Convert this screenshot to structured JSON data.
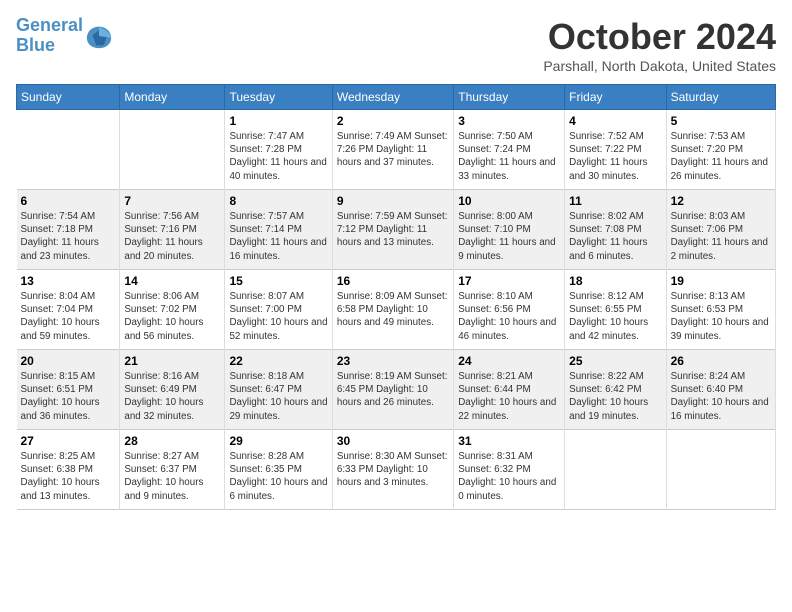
{
  "header": {
    "logo_line1": "General",
    "logo_line2": "Blue",
    "month": "October 2024",
    "location": "Parshall, North Dakota, United States"
  },
  "days_of_week": [
    "Sunday",
    "Monday",
    "Tuesday",
    "Wednesday",
    "Thursday",
    "Friday",
    "Saturday"
  ],
  "weeks": [
    [
      {
        "day": "",
        "content": ""
      },
      {
        "day": "",
        "content": ""
      },
      {
        "day": "1",
        "content": "Sunrise: 7:47 AM\nSunset: 7:28 PM\nDaylight: 11 hours and 40 minutes."
      },
      {
        "day": "2",
        "content": "Sunrise: 7:49 AM\nSunset: 7:26 PM\nDaylight: 11 hours and 37 minutes."
      },
      {
        "day": "3",
        "content": "Sunrise: 7:50 AM\nSunset: 7:24 PM\nDaylight: 11 hours and 33 minutes."
      },
      {
        "day": "4",
        "content": "Sunrise: 7:52 AM\nSunset: 7:22 PM\nDaylight: 11 hours and 30 minutes."
      },
      {
        "day": "5",
        "content": "Sunrise: 7:53 AM\nSunset: 7:20 PM\nDaylight: 11 hours and 26 minutes."
      }
    ],
    [
      {
        "day": "6",
        "content": "Sunrise: 7:54 AM\nSunset: 7:18 PM\nDaylight: 11 hours and 23 minutes."
      },
      {
        "day": "7",
        "content": "Sunrise: 7:56 AM\nSunset: 7:16 PM\nDaylight: 11 hours and 20 minutes."
      },
      {
        "day": "8",
        "content": "Sunrise: 7:57 AM\nSunset: 7:14 PM\nDaylight: 11 hours and 16 minutes."
      },
      {
        "day": "9",
        "content": "Sunrise: 7:59 AM\nSunset: 7:12 PM\nDaylight: 11 hours and 13 minutes."
      },
      {
        "day": "10",
        "content": "Sunrise: 8:00 AM\nSunset: 7:10 PM\nDaylight: 11 hours and 9 minutes."
      },
      {
        "day": "11",
        "content": "Sunrise: 8:02 AM\nSunset: 7:08 PM\nDaylight: 11 hours and 6 minutes."
      },
      {
        "day": "12",
        "content": "Sunrise: 8:03 AM\nSunset: 7:06 PM\nDaylight: 11 hours and 2 minutes."
      }
    ],
    [
      {
        "day": "13",
        "content": "Sunrise: 8:04 AM\nSunset: 7:04 PM\nDaylight: 10 hours and 59 minutes."
      },
      {
        "day": "14",
        "content": "Sunrise: 8:06 AM\nSunset: 7:02 PM\nDaylight: 10 hours and 56 minutes."
      },
      {
        "day": "15",
        "content": "Sunrise: 8:07 AM\nSunset: 7:00 PM\nDaylight: 10 hours and 52 minutes."
      },
      {
        "day": "16",
        "content": "Sunrise: 8:09 AM\nSunset: 6:58 PM\nDaylight: 10 hours and 49 minutes."
      },
      {
        "day": "17",
        "content": "Sunrise: 8:10 AM\nSunset: 6:56 PM\nDaylight: 10 hours and 46 minutes."
      },
      {
        "day": "18",
        "content": "Sunrise: 8:12 AM\nSunset: 6:55 PM\nDaylight: 10 hours and 42 minutes."
      },
      {
        "day": "19",
        "content": "Sunrise: 8:13 AM\nSunset: 6:53 PM\nDaylight: 10 hours and 39 minutes."
      }
    ],
    [
      {
        "day": "20",
        "content": "Sunrise: 8:15 AM\nSunset: 6:51 PM\nDaylight: 10 hours and 36 minutes."
      },
      {
        "day": "21",
        "content": "Sunrise: 8:16 AM\nSunset: 6:49 PM\nDaylight: 10 hours and 32 minutes."
      },
      {
        "day": "22",
        "content": "Sunrise: 8:18 AM\nSunset: 6:47 PM\nDaylight: 10 hours and 29 minutes."
      },
      {
        "day": "23",
        "content": "Sunrise: 8:19 AM\nSunset: 6:45 PM\nDaylight: 10 hours and 26 minutes."
      },
      {
        "day": "24",
        "content": "Sunrise: 8:21 AM\nSunset: 6:44 PM\nDaylight: 10 hours and 22 minutes."
      },
      {
        "day": "25",
        "content": "Sunrise: 8:22 AM\nSunset: 6:42 PM\nDaylight: 10 hours and 19 minutes."
      },
      {
        "day": "26",
        "content": "Sunrise: 8:24 AM\nSunset: 6:40 PM\nDaylight: 10 hours and 16 minutes."
      }
    ],
    [
      {
        "day": "27",
        "content": "Sunrise: 8:25 AM\nSunset: 6:38 PM\nDaylight: 10 hours and 13 minutes."
      },
      {
        "day": "28",
        "content": "Sunrise: 8:27 AM\nSunset: 6:37 PM\nDaylight: 10 hours and 9 minutes."
      },
      {
        "day": "29",
        "content": "Sunrise: 8:28 AM\nSunset: 6:35 PM\nDaylight: 10 hours and 6 minutes."
      },
      {
        "day": "30",
        "content": "Sunrise: 8:30 AM\nSunset: 6:33 PM\nDaylight: 10 hours and 3 minutes."
      },
      {
        "day": "31",
        "content": "Sunrise: 8:31 AM\nSunset: 6:32 PM\nDaylight: 10 hours and 0 minutes."
      },
      {
        "day": "",
        "content": ""
      },
      {
        "day": "",
        "content": ""
      }
    ]
  ]
}
